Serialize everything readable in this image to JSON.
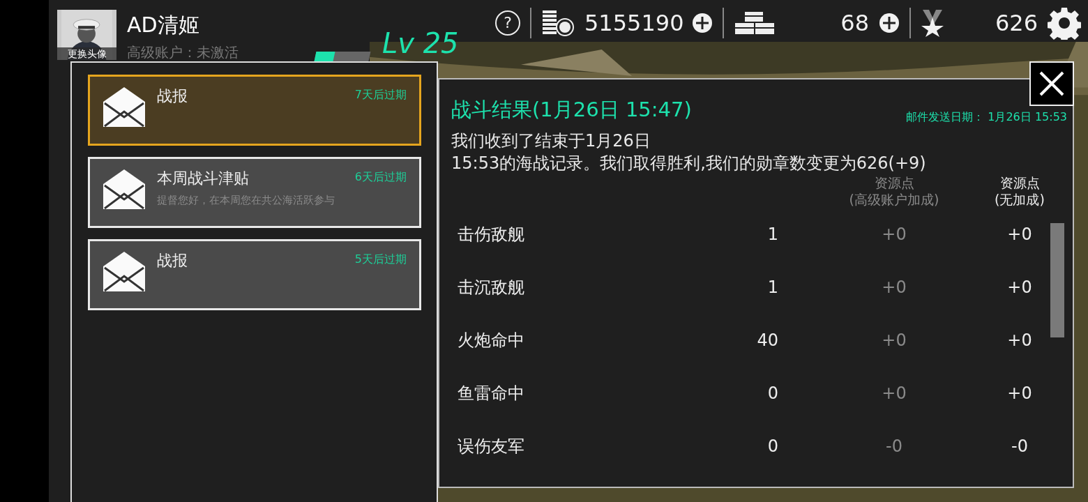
{
  "player": {
    "avatar_caption": "更换头像",
    "name": "AD清姬",
    "premium_status": "高级账户：未激活",
    "xp": {
      "level": 0.35
    },
    "level_label": "Lv 25"
  },
  "help_label": "?",
  "resources": [
    {
      "kind": "coins",
      "value": "5155190",
      "addable": true
    },
    {
      "kind": "crates",
      "value": "68",
      "addable": true
    },
    {
      "kind": "medals",
      "value": "626",
      "addable": false
    }
  ],
  "mails": [
    {
      "title": "战报",
      "expiry": "7天后过期",
      "selected": true
    },
    {
      "title": "本周战斗津贴",
      "preview": "提督您好，在本周您在共公海活跃参与",
      "expiry": "6天后过期",
      "selected": false
    },
    {
      "title": "战报",
      "expiry": "5天后过期",
      "selected": false
    }
  ],
  "detail": {
    "title": "战斗结果(1月26日 15:47)",
    "sent": "邮件发送日期：  1月26日 15:53",
    "body_lines": [
      "我们收到了结束于1月26日",
      "15:53的海战记录。我们取得胜利,我们的勋章数变更为626(+9)"
    ],
    "columns": [
      {
        "lines": [
          "资源点",
          "(高级账户加成)"
        ],
        "muted": true
      },
      {
        "lines": [
          "资源点",
          "(无加成)"
        ],
        "muted": false
      }
    ],
    "rows": [
      {
        "label": "击伤敌舰",
        "count": "1",
        "bonus": "+0",
        "base": "+0"
      },
      {
        "label": "击沉敌舰",
        "count": "1",
        "bonus": "+0",
        "base": "+0"
      },
      {
        "label": "火炮命中",
        "count": "40",
        "bonus": "+0",
        "base": "+0"
      },
      {
        "label": "鱼雷命中",
        "count": "0",
        "bonus": "+0",
        "base": "+0"
      },
      {
        "label": "误伤友军",
        "count": "0",
        "bonus": "-0",
        "base": "-0"
      }
    ]
  }
}
